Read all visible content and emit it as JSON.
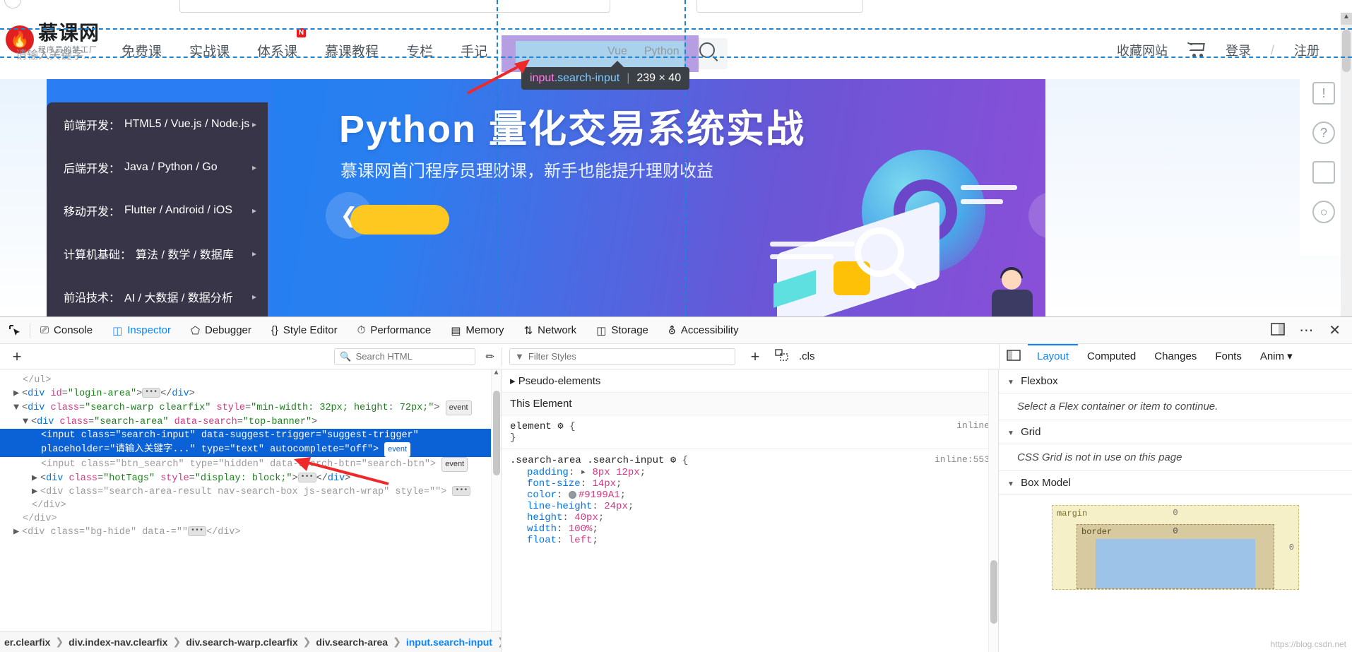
{
  "site": {
    "logo": {
      "main": "慕课网",
      "sub": "程序员的梦工厂",
      "icon": "flame-icon"
    },
    "nav": [
      {
        "label": "免费课",
        "badge": ""
      },
      {
        "label": "实战课",
        "badge": ""
      },
      {
        "label": "体系课",
        "badge": "N"
      },
      {
        "label": "慕课教程",
        "badge": ""
      },
      {
        "label": "专栏",
        "badge": ""
      },
      {
        "label": "手记",
        "badge": ""
      }
    ],
    "search": {
      "placeholder": "请输入关键字...",
      "value": "",
      "hot_tags": [
        "Vue",
        "Python"
      ],
      "button_icon": "search-icon",
      "highlight_padding_color": "#a98ede",
      "highlight_content_color": "#a8d7ee"
    },
    "header_right": {
      "favorite": "收藏网站",
      "cart_icon": "shopping-cart-icon",
      "login": "登录",
      "separator": "/",
      "register": "注册"
    },
    "banner": {
      "title": "Python 量化交易系统实战",
      "subtitle": "慕课网首门程序员理财课，新手也能提升理财收益",
      "prev_icon": "chevron-left-icon",
      "next_icon": "chevron-right-icon",
      "menu": [
        {
          "key": "前端开发：",
          "value": "HTML5 / Vue.js / Node.js"
        },
        {
          "key": "后端开发：",
          "value": "Java / Python / Go"
        },
        {
          "key": "移动开发：",
          "value": "Flutter / Android / iOS"
        },
        {
          "key": "计算机基础：",
          "value": "算法 / 数学 / 数据库"
        },
        {
          "key": "前沿技术：",
          "value": "AI / 大数据 / 数据分析"
        }
      ]
    },
    "rail": [
      "feedback-icon",
      "help-icon",
      "mobile-icon",
      "chat-icon"
    ]
  },
  "inspector_tooltip": {
    "selector": "input.search-input",
    "divider": "|",
    "dimensions": "239 × 40"
  },
  "devtools": {
    "picker_icon": "element-picker-icon",
    "tabs": [
      {
        "label": "Console",
        "icon": "console-icon",
        "active": false
      },
      {
        "label": "Inspector",
        "icon": "inspector-icon",
        "active": true
      },
      {
        "label": "Debugger",
        "icon": "debugger-icon",
        "active": false
      },
      {
        "label": "Style Editor",
        "icon": "style-editor-icon",
        "active": false
      },
      {
        "label": "Performance",
        "icon": "performance-icon",
        "active": false
      },
      {
        "label": "Memory",
        "icon": "memory-icon",
        "active": false
      },
      {
        "label": "Network",
        "icon": "network-icon",
        "active": false
      },
      {
        "label": "Storage",
        "icon": "storage-icon",
        "active": false
      },
      {
        "label": "Accessibility",
        "icon": "accessibility-icon",
        "active": false
      }
    ],
    "right_icons": [
      "split-console-icon",
      "more-options-icon",
      "close-devtools-icon"
    ],
    "subbar": {
      "add_node_icon": "plus-icon",
      "search_html_placeholder": "Search HTML",
      "eyedropper_icon": "eyedropper-icon",
      "filter_styles_placeholder": "Filter Styles",
      "add_rule_icon": "plus-icon",
      "toggle_print_icon": "print-media-icon",
      "cls_label": ".cls",
      "layout_toggle_icon": "toggle-sidebar-icon"
    },
    "right_tabs": [
      {
        "label": "Layout",
        "active": true
      },
      {
        "label": "Computed",
        "active": false
      },
      {
        "label": "Changes",
        "active": false
      },
      {
        "label": "Fonts",
        "active": false
      },
      {
        "label": "Anim",
        "active": false
      }
    ],
    "markup_lines": [
      {
        "indent": 2,
        "html": "<span class=\"pun dim\">&lt;/ul&gt;</span>",
        "selected": false
      },
      {
        "indent": 1,
        "html": "<span class=\"tw\">▶</span><span class=\"pun\">&lt;</span><span class=\"tag\">div</span> <span class=\"attr\">id</span><span class=\"pun\">=</span><span class=\"val\">\"login-area\"</span><span class=\"pun\">&gt;</span><span class=\"dots\">•••</span><span class=\"pun\">&lt;/</span><span class=\"tag\">div</span><span class=\"pun\">&gt;</span>",
        "selected": false
      },
      {
        "indent": 1,
        "html": "<span class=\"tw\">▼</span><span class=\"pun\">&lt;</span><span class=\"tag\">div</span> <span class=\"attr\">class</span><span class=\"pun\">=</span><span class=\"val\">\"search-warp clearfix\"</span> <span class=\"attr\">style</span><span class=\"pun\">=</span><span class=\"val\">\"min-width: 32px; height: 72px;\"</span><span class=\"pun\">&gt;</span> <span class=\"evt\">event</span>",
        "selected": false
      },
      {
        "indent": 2,
        "html": "<span class=\"tw\">▼</span><span class=\"pun\">&lt;</span><span class=\"tag\">div</span> <span class=\"attr\">class</span><span class=\"pun\">=</span><span class=\"val\">\"search-area\"</span> <span class=\"attr\">data-search</span><span class=\"pun\">=</span><span class=\"val\">\"top-banner\"</span><span class=\"pun\">&gt;</span>",
        "selected": false
      },
      {
        "indent": 4,
        "html": "<span class=\"pun\">&lt;</span><span class=\"tag\">input</span> <span class=\"attr\">class</span><span class=\"pun\">=</span><span class=\"val\">\"search-input\"</span> <span class=\"attr\">data-suggest-trigger</span><span class=\"pun\">=</span><span class=\"val\">\"suggest-trigger\"</span>",
        "selected": true
      },
      {
        "indent": 4,
        "html": "<span class=\"attr\">placeholder</span><span class=\"pun\">=</span><span class=\"val\">\"请输入关键字...\"</span> <span class=\"attr\">type</span><span class=\"pun\">=</span><span class=\"val\">\"text\"</span> <span class=\"attr\">autocomplete</span><span class=\"pun\">=</span><span class=\"val\">\"off\"</span><span class=\"pun\">&gt;</span> <span class=\"evt\">event</span>",
        "selected": true
      },
      {
        "indent": 4,
        "html": "<span class=\"pun dim\">&lt;</span><span class=\"dim\">input</span> <span class=\"dim\">class</span><span class=\"dim\">=</span><span class=\"dim\">\"btn_search\"</span> <span class=\"dim\">type</span><span class=\"dim\">=</span><span class=\"dim\">\"hidden\"</span> <span class=\"dim\">data-search-btn</span><span class=\"dim\">=</span><span class=\"dim\">\"search-btn\"</span><span class=\"dim\">&gt;</span> <span class=\"evt\">event</span>",
        "selected": false
      },
      {
        "indent": 3,
        "html": "<span class=\"tw\">▶</span><span class=\"pun\">&lt;</span><span class=\"tag\">div</span> <span class=\"attr\">class</span><span class=\"pun\">=</span><span class=\"val\">\"hotTags\"</span> <span class=\"attr\">style</span><span class=\"pun\">=</span><span class=\"val\">\"display: block;\"</span><span class=\"pun\">&gt;</span><span class=\"dots\">•••</span><span class=\"pun\">&lt;/</span><span class=\"tag\">div</span><span class=\"pun\">&gt;</span>",
        "selected": false
      },
      {
        "indent": 3,
        "html": "<span class=\"tw\">▶</span><span class=\"pun dim\">&lt;</span><span class=\"dim\">div</span> <span class=\"dim\">class</span><span class=\"dim\">=</span><span class=\"dim\">\"search-area-result nav-search-box js-search-wrap\"</span> <span class=\"dim\">style</span><span class=\"dim\">=</span><span class=\"dim\">\"\"</span><span class=\"dim\">&gt;</span> <span class=\"dots\">•••</span>",
        "selected": false
      },
      {
        "indent": 3,
        "html": "<span class=\"pun dim\">&lt;/div&gt;</span>",
        "selected": false
      },
      {
        "indent": 2,
        "html": "<span class=\"pun dim\">&lt;/div&gt;</span>",
        "selected": false
      },
      {
        "indent": 1,
        "html": "<span class=\"tw\">▶</span><span class=\"pun dim\">&lt;</span><span class=\"dim\">div</span> <span class=\"dim\">class</span><span class=\"dim\">=</span><span class=\"dim\">\"bg-hide\"</span> <span class=\"dim\">data-</span><span class=\"dim\">=</span><span class=\"dim\">\"\"</span><span class=\"dots\">•••</span><span class=\"dim\">&lt;/div&gt;</span>",
        "selected": false
      }
    ],
    "breadcrumb": [
      "er.clearfix",
      "div.index-nav.clearfix",
      "div.search-warp.clearfix",
      "div.search-area",
      "input.search-input"
    ],
    "rules": {
      "pseudo_elements": "Pseudo-elements",
      "this_element": "This Element",
      "element_rule": "element",
      "element_source": "inline",
      "selector": ".search-area .search-input",
      "selector_source": "inline:553",
      "declarations": [
        {
          "prop": "padding",
          "value": "8px 12px",
          "expandable": true,
          "swatch": ""
        },
        {
          "prop": "font-size",
          "value": "14px",
          "expandable": false,
          "swatch": ""
        },
        {
          "prop": "color",
          "value": "#9199A1",
          "expandable": false,
          "swatch": "#9199A1"
        },
        {
          "prop": "line-height",
          "value": "24px",
          "expandable": false,
          "swatch": ""
        },
        {
          "prop": "height",
          "value": "40px",
          "expandable": false,
          "swatch": ""
        },
        {
          "prop": "width",
          "value": "100%",
          "expandable": false,
          "swatch": ""
        },
        {
          "prop": "float",
          "value": "left",
          "expandable": false,
          "swatch": ""
        }
      ]
    },
    "layout": {
      "flexbox_title": "Flexbox",
      "flexbox_note": "Select a Flex container or item to continue.",
      "grid_title": "Grid",
      "grid_note": "CSS Grid is not in use on this page",
      "boxmodel_title": "Box Model",
      "margin_label": "margin",
      "margin_top": "0",
      "margin_right": "0",
      "border_label": "border",
      "border_top": "0"
    }
  },
  "watermark": "https://blog.csdn.net"
}
